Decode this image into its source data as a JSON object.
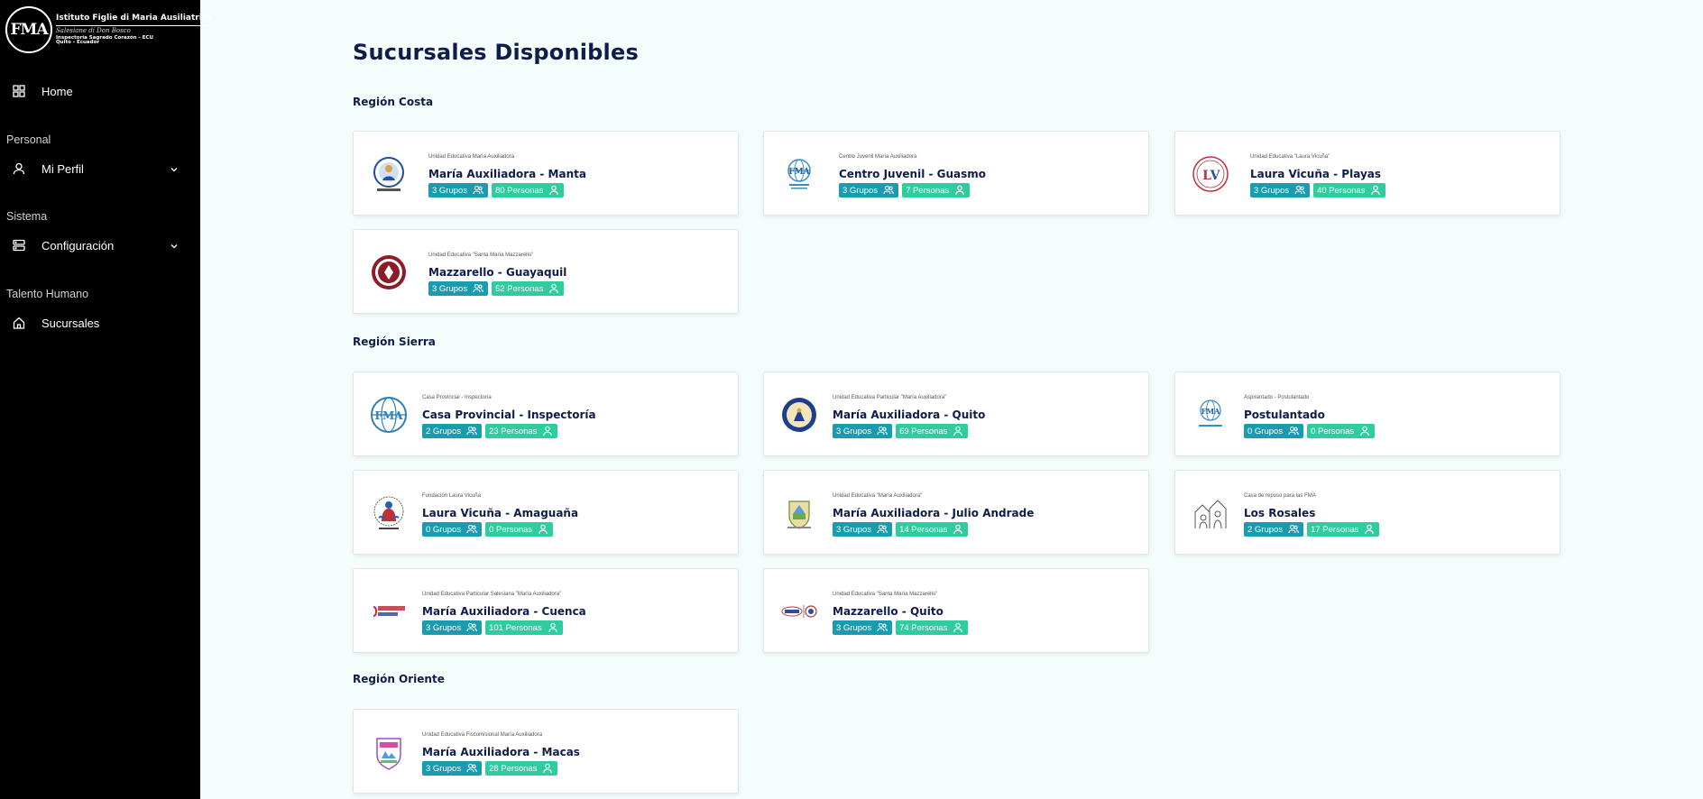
{
  "brand": {
    "logo_text": "FMA",
    "title": "Istituto Figlie di Maria Ausiliatrice",
    "subtitle": "Salesiane di Don Bosco",
    "line1": "Inspectoría Sagrado Corazón - ECU",
    "line2": "Quito - Ecuador"
  },
  "sidebar": {
    "home": "Home",
    "personal_section": "Personal",
    "profile": "Mi Perfil",
    "system_section": "Sistema",
    "config": "Configuración",
    "talent_section": "Talento Humano",
    "branches": "Sucursales"
  },
  "page": {
    "title": "Sucursales Disponibles"
  },
  "regions": [
    {
      "name": "Región Costa",
      "cards": [
        {
          "subtitle": "Unidad Educativa María Auxiliadora",
          "name": "María Auxiliadora - Manta",
          "groups": "3 Grupos",
          "people": "80 Personas",
          "logo_icon": "seal-blue-icon"
        },
        {
          "subtitle": "Centro Juvenil María Auxiliadora",
          "name": "Centro Juvenil - Guasmo",
          "groups": "3 Grupos",
          "people": "7 Personas",
          "logo_icon": "fma-globe-icon"
        },
        {
          "subtitle": "Unidad Educativa \"Laura Vicuña\"",
          "name": "Laura Vicuña - Playas",
          "groups": "3 Grupos",
          "people": "40 Personas",
          "logo_icon": "lv-crest-icon"
        },
        {
          "subtitle": "Unidad Educativa \"Santa María Mazzarello\"",
          "name": "Mazzarello - Guayaquil",
          "groups": "3 Grupos",
          "people": "52 Personas",
          "logo_icon": "red-shield-icon"
        }
      ]
    },
    {
      "name": "Región Sierra",
      "cards": [
        {
          "subtitle": "Casa Provincial - Inspectoría",
          "name": "Casa Provincial - Inspectoría",
          "groups": "2 Grupos",
          "people": "23 Personas",
          "logo_icon": "fma-globe-icon"
        },
        {
          "subtitle": "Unidad Educativa Particular \"María Auxiliadora\"",
          "name": "María Auxiliadora - Quito",
          "groups": "3 Grupos",
          "people": "69 Personas",
          "logo_icon": "seal-blue-icon"
        },
        {
          "subtitle": "Aspirantado - Postulantado",
          "name": "Postulantado",
          "groups": "0 Grupos",
          "people": "0 Personas",
          "logo_icon": "fma-globe-icon"
        },
        {
          "subtitle": "Fundación Laura Vicuña",
          "name": "Laura Vicuña - Amaguaña",
          "groups": "0 Grupos",
          "people": "0 Personas",
          "logo_icon": "hands-icon"
        },
        {
          "subtitle": "Unidad Educativa \"María Auxiliadora\"",
          "name": "María Auxiliadora - Julio Andrade",
          "groups": "3 Grupos",
          "people": "14 Personas",
          "logo_icon": "crest-icon"
        },
        {
          "subtitle": "Casa de reposo para las FMA",
          "name": "Los Rosales",
          "groups": "2 Grupos",
          "people": "17 Personas",
          "logo_icon": "sketch-icon"
        },
        {
          "subtitle": "Unidad Educativa Particular Salesiana \"María Auxiliadora\"",
          "name": "María Auxiliadora - Cuenca",
          "groups": "3 Grupos",
          "people": "101 Personas",
          "logo_icon": "uesma-logo-icon"
        },
        {
          "subtitle": "Unidad Educativa \"Santa María Mazzarello\"",
          "name": "Mazzarello - Quito",
          "groups": "3 Grupos",
          "people": "74 Personas",
          "logo_icon": "wordmark-icon"
        }
      ]
    },
    {
      "name": "Región Oriente",
      "cards": [
        {
          "subtitle": "Unidad Educativa Fiscomisional María Auxiliadora",
          "name": "María Auxiliadora - Macas",
          "groups": "3 Grupos",
          "people": "28 Personas",
          "logo_icon": "shield-color-icon"
        }
      ]
    }
  ],
  "colors": {
    "sidebar_bg": "#000000",
    "page_bg": "#f4fcfc",
    "title_text": "#0f1d4a",
    "groups_badge": "#1a9cb0",
    "people_badge": "#2ecc9f"
  }
}
